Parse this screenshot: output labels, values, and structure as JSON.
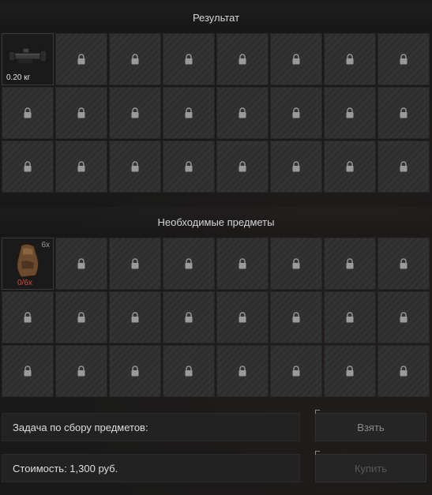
{
  "result_section": {
    "title": "Результат",
    "item": {
      "icon": "rifle-scope-icon",
      "weight": "0.20 кг"
    },
    "locked_slots": 23
  },
  "required_section": {
    "title": "Необходимые предметы",
    "item": {
      "icon": "ration-pack-icon",
      "quantity": "6x",
      "have": "0/6x",
      "have_color": "#d44a3a"
    },
    "locked_slots": 23
  },
  "task": {
    "label": "Задача по сбору предметов:"
  },
  "cost": {
    "label": "Стоимость: 1,300 руб."
  },
  "buttons": {
    "take": "Взять",
    "buy": "Купить"
  }
}
